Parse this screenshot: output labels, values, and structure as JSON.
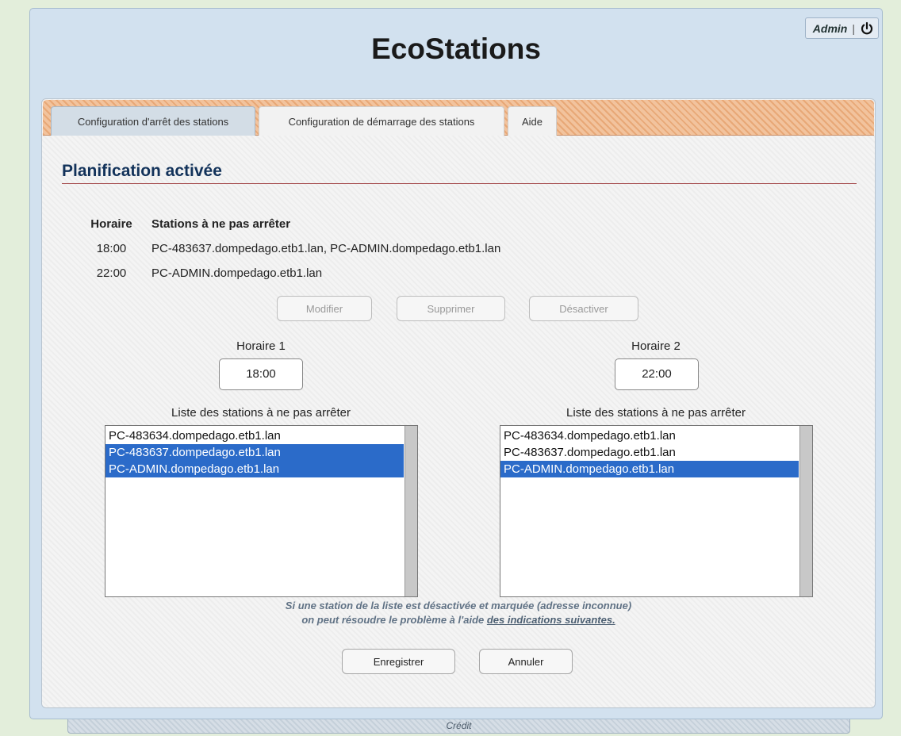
{
  "app": {
    "title": "EcoStations"
  },
  "user": {
    "name": "Admin",
    "separator": "|",
    "logout_icon": "power-icon"
  },
  "tabs": [
    {
      "label": "Configuration d'arrêt des stations",
      "active": true
    },
    {
      "label": "Configuration de démarrage des stations",
      "active": false
    },
    {
      "label": "Aide",
      "active": false
    }
  ],
  "section": {
    "title": "Planification activée"
  },
  "schedule": {
    "headers": {
      "time": "Horaire",
      "stations": "Stations à ne pas arrêter"
    },
    "rows": [
      {
        "time": "18:00",
        "stations": "PC-483637.dompedago.etb1.lan, PC-ADMIN.dompedago.etb1.lan"
      },
      {
        "time": "22:00",
        "stations": "PC-ADMIN.dompedago.etb1.lan"
      }
    ]
  },
  "actions": {
    "modify": "Modifier",
    "delete": "Supprimer",
    "disable": "Désactiver"
  },
  "horaire1": {
    "label": "Horaire 1",
    "value": "18:00",
    "list_label": "Liste des stations à ne pas arrêter",
    "items": [
      {
        "text": "PC-483634.dompedago.etb1.lan",
        "selected": false
      },
      {
        "text": "PC-483637.dompedago.etb1.lan",
        "selected": true
      },
      {
        "text": "PC-ADMIN.dompedago.etb1.lan",
        "selected": true
      }
    ]
  },
  "horaire2": {
    "label": "Horaire 2",
    "value": "22:00",
    "list_label": "Liste des stations à ne pas arrêter",
    "items": [
      {
        "text": "PC-483634.dompedago.etb1.lan",
        "selected": false
      },
      {
        "text": "PC-483637.dompedago.etb1.lan",
        "selected": false
      },
      {
        "text": "PC-ADMIN.dompedago.etb1.lan",
        "selected": true
      }
    ]
  },
  "note": {
    "line1": "Si une station de la liste est désactivée et marquée (adresse inconnue)",
    "line2_prefix": "on peut résoudre le problème à l'aide ",
    "link": "des indications suivantes."
  },
  "footer_buttons": {
    "save": "Enregistrer",
    "cancel": "Annuler"
  },
  "credit": "Crédit",
  "colors": {
    "accent_blue": "#12325a",
    "selection": "#2b6bc9",
    "tabbar_orange": "#e8a877"
  }
}
